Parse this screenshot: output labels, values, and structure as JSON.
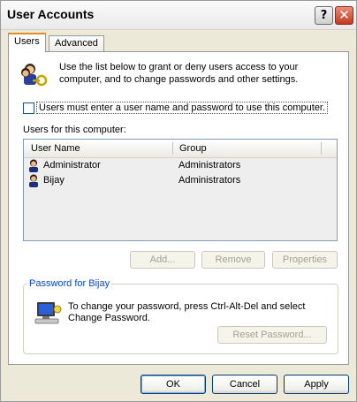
{
  "window": {
    "title": "User Accounts",
    "help_label": "?",
    "close_label": "✕"
  },
  "tabs": [
    {
      "label": "Users",
      "active": true
    },
    {
      "label": "Advanced",
      "active": false
    }
  ],
  "intro": {
    "line1": "Use the list below to grant or deny users access to your",
    "line2": "computer, and to change passwords and other settings.",
    "icon": "users-keys-icon"
  },
  "checkbox": {
    "label": "Users must enter a user name and password to use this computer.",
    "checked": false
  },
  "users_list": {
    "caption": "Users for this computer:",
    "columns": [
      "User Name",
      "Group"
    ],
    "rows": [
      {
        "name": "Administrator",
        "group": "Administrators"
      },
      {
        "name": "Bijay",
        "group": "Administrators"
      }
    ]
  },
  "list_buttons": {
    "add": "Add...",
    "remove": "Remove",
    "properties": "Properties"
  },
  "password_group": {
    "title": "Password for Bijay",
    "line1": "To change your password, press Ctrl-Alt-Del and select",
    "line2": "Change Password.",
    "reset_button": "Reset Password...",
    "icon": "computer-icon"
  },
  "footer": {
    "ok": "OK",
    "cancel": "Cancel",
    "apply": "Apply"
  }
}
